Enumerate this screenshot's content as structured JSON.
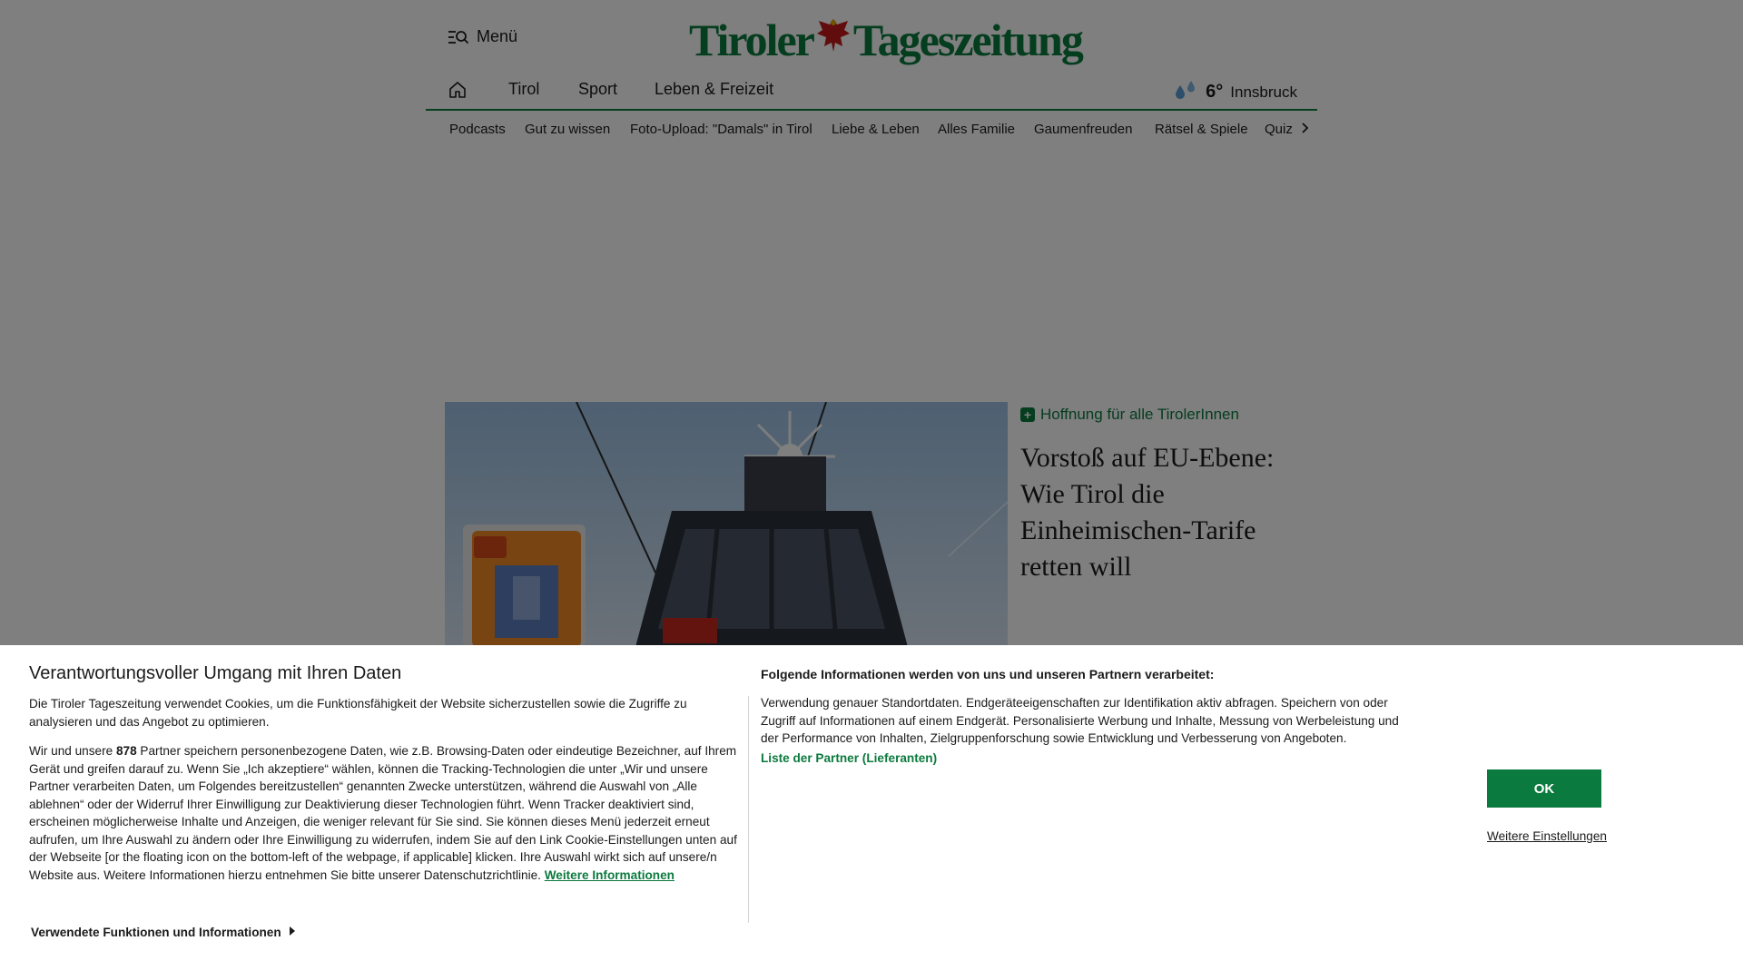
{
  "header": {
    "menu_label": "Menü",
    "logo_text_left": "Tiroler",
    "logo_text_right": "Tageszeitung",
    "brand_color": "#0b7a3e"
  },
  "nav_main": {
    "items": [
      "Tirol",
      "Sport",
      "Leben & Freizeit"
    ]
  },
  "weather": {
    "temp": "6°",
    "city": "Innsbruck"
  },
  "nav_sub": {
    "items": [
      "Podcasts",
      "Gut zu wissen",
      "Foto-Upload: \"Damals\" in Tirol",
      "Liebe & Leben",
      "Alles Familie",
      "Gaumenfreuden",
      "Rätsel & Spiele",
      "Quiz"
    ]
  },
  "teaser": {
    "kicker": "Hoffnung für alle TirolerInnen",
    "headline": "Vorstoß auf EU-Ebene: Wie Tirol die Einheimischen-Tarife retten will"
  },
  "consent": {
    "title": "Verantwortungsvoller Umgang mit Ihren Daten",
    "p1": "Die Tiroler Tageszeitung verwendet Cookies, um die Funktionsfähigkeit der Website sicherzustellen sowie die Zugriffe zu analysieren und das Angebot zu optimieren.",
    "p2_prefix": "Wir und unsere ",
    "p2_count": "878",
    "p2_rest": " Partner speichern personenbezogene Daten, wie z.B. Browsing-Daten oder eindeutige Bezeichner, auf Ihrem Gerät und greifen darauf zu. Wenn Sie „Ich akzeptiere“ wählen, können die Tracking-Technologien die unter „Wir und unsere Partner verarbeiten Daten, um Folgendes bereitzustellen“ genannten Zwecke unterstützen, während die Auswahl von „Alle ablehnen“ oder der Widerruf Ihrer Einwilligung zur Deaktivierung dieser Technologien führt. Wenn Tracker deaktiviert sind, erscheinen möglicherweise Inhalte und Anzeigen, die weniger relevant für Sie sind. Sie können dieses Menü jederzeit erneut aufrufen, um Ihre Auswahl zu ändern oder Ihre Einwilligung zu widerrufen, indem Sie auf den Link Cookie-Einstellungen unten auf der Webseite [or the floating icon on the bottom-left of the webpage, if applicable] klicken. Ihre Auswahl wirkt sich auf unsere/n Website aus. Weitere Informationen hierzu entnehmen Sie bitte unserer Datenschutzrichtlinie. ",
    "more_info_link": "Weitere Informationen",
    "right_title": "Folgende Informationen werden von uns und unseren Partnern verarbeitet:",
    "right_text": "Verwendung genauer Standortdaten. Endgeräteeigenschaften zur Identifikation aktiv abfragen. Speichern von oder Zugriff auf Informationen auf einem Endgerät. Personalisierte Werbung und Inhalte, Messung von Werbeleistung und der Performance von Inhalten, Zielgruppenforschung sowie Entwicklung und Verbesserung von Angeboten.",
    "partners_link": "Liste der Partner (Lieferanten)",
    "ok_label": "OK",
    "settings_label": "Weitere Einstellungen",
    "functions_label": "Verwendete Funktionen und Informationen"
  }
}
